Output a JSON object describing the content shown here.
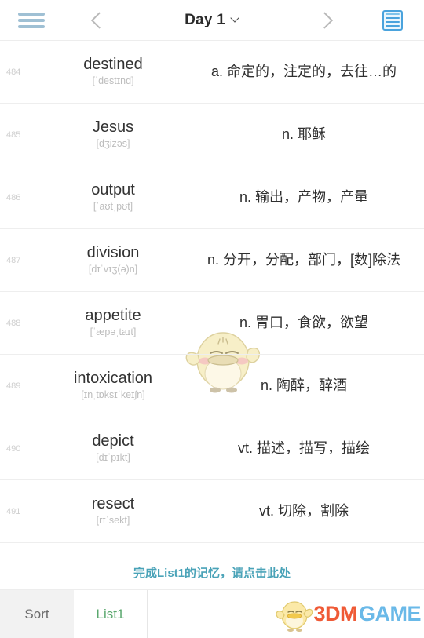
{
  "header": {
    "menu_icon": "hamburger-menu-icon",
    "prev_icon": "chevron-left-icon",
    "title": "Day 1",
    "caret_icon": "chevron-down-icon",
    "next_icon": "chevron-right-icon",
    "list_icon": "list-view-icon"
  },
  "words": [
    {
      "num": "484",
      "word": "destined",
      "ipa": "[ˈdestɪnd]",
      "def": "a. 命定的，注定的，去往…的"
    },
    {
      "num": "485",
      "word": "Jesus",
      "ipa": "[dʒizəs]",
      "def": "n. 耶稣"
    },
    {
      "num": "486",
      "word": "output",
      "ipa": "[ˈaʊtˌpʊt]",
      "def": "n. 输出，产物，产量"
    },
    {
      "num": "487",
      "word": "division",
      "ipa": "[dɪˈvɪʒ(ə)n]",
      "def": "n. 分开，分配，部门，[数]除法"
    },
    {
      "num": "488",
      "word": "appetite",
      "ipa": "[ˈæpəˌtaɪt]",
      "def": "n. 胃口，食欲，欲望"
    },
    {
      "num": "489",
      "word": "intoxication",
      "ipa": "[ɪnˌtɒksɪˈkeɪʃn]",
      "def": "n. 陶醉，醉酒"
    },
    {
      "num": "490",
      "word": "depict",
      "ipa": "[dɪˈpɪkt]",
      "def": "vt. 描述，描写，描绘"
    },
    {
      "num": "491",
      "word": "resect",
      "ipa": "[rɪˈsekt]",
      "def": "vt. 切除，割除"
    }
  ],
  "finish": {
    "text": "完成List1的记忆，请点击此处",
    "color": "#4aa3b8"
  },
  "tabbar": {
    "sort_label": "Sort",
    "list_label": "List1",
    "list_color": "#5aa86e"
  },
  "brand": {
    "part1": "3DM",
    "part2": "GAME",
    "color1": "#ef5a36",
    "color2": "#6ab9e8",
    "mascot_icon": "chick-mascot-icon"
  },
  "watermark": {
    "icon": "chick-mascot-watermark"
  }
}
